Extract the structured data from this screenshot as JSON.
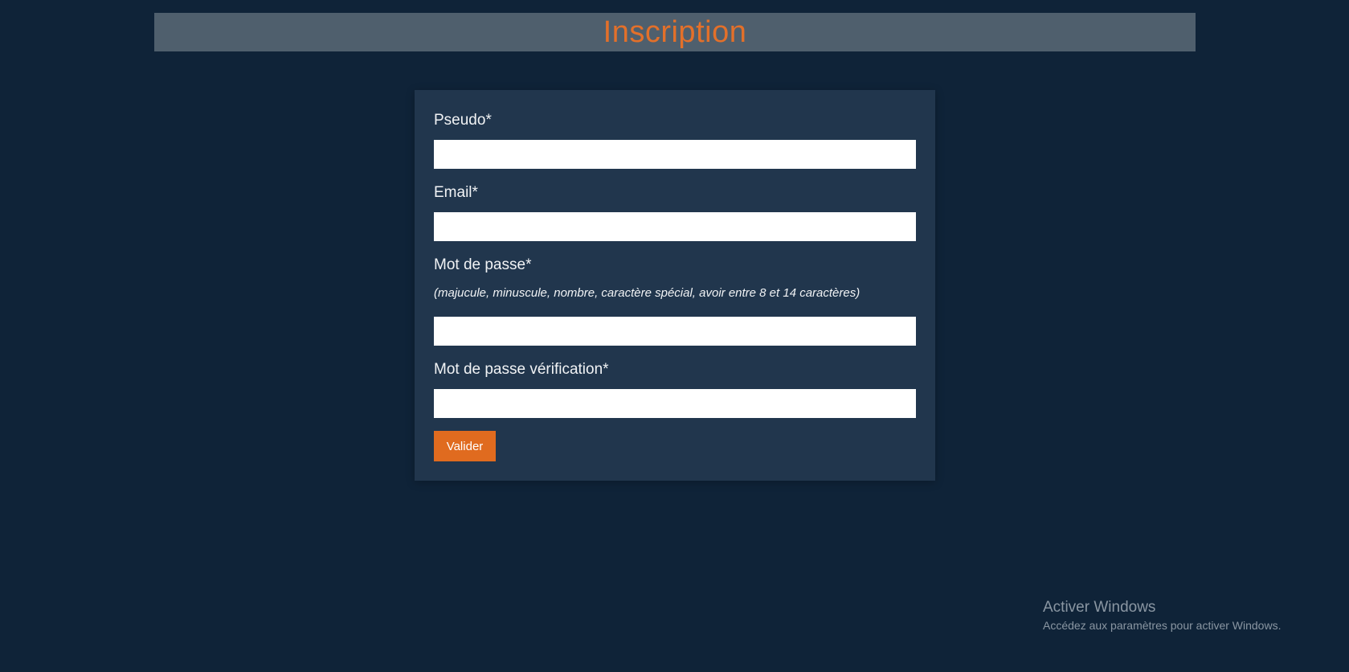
{
  "header": {
    "title": "Inscription"
  },
  "form": {
    "fields": {
      "pseudo": {
        "label": "Pseudo*",
        "value": ""
      },
      "email": {
        "label": "Email*",
        "value": ""
      },
      "password": {
        "label": "Mot de passe*",
        "hint": "(majucule, minuscule, nombre, caractère spécial, avoir entre 8 et 14 caractères)",
        "value": ""
      },
      "password_confirm": {
        "label": "Mot de passe vérification*",
        "value": ""
      }
    },
    "submit_label": "Valider"
  },
  "windows_watermark": {
    "title": "Activer Windows",
    "subtitle": "Accédez aux paramètres pour activer Windows."
  },
  "colors": {
    "background": "#0f2338",
    "header_bar": "#4f5f6d",
    "accent": "#e3702a",
    "card": "#21364d",
    "button": "#e06b1f"
  }
}
